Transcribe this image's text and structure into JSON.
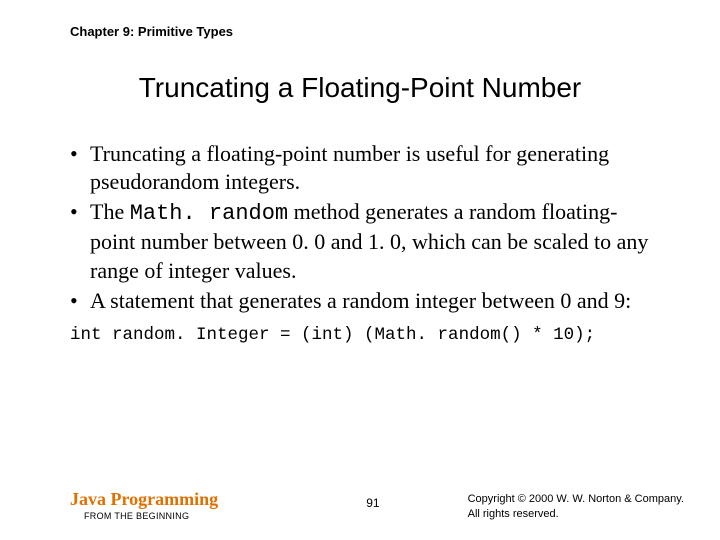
{
  "chapter": "Chapter 9: Primitive Types",
  "title": "Truncating a Floating-Point Number",
  "bullets": {
    "b1a": "Truncating a floating-point number is useful for generating pseudorandom integers.",
    "b2a": "The ",
    "b2code": "Math. random",
    "b2b": " method generates a random floating-point number between 0. 0 and 1. 0, which can be scaled to any range of integer values.",
    "b3a": "A statement that generates a random integer between 0 and 9:"
  },
  "code_line": "int random. Integer = (int) (Math. random() * 10);",
  "footer": {
    "book_title": "Java Programming",
    "book_sub": "FROM THE BEGINNING",
    "page": "91",
    "copyright_l1": "Copyright © 2000 W. W. Norton & Company.",
    "copyright_l2": "All rights reserved."
  }
}
